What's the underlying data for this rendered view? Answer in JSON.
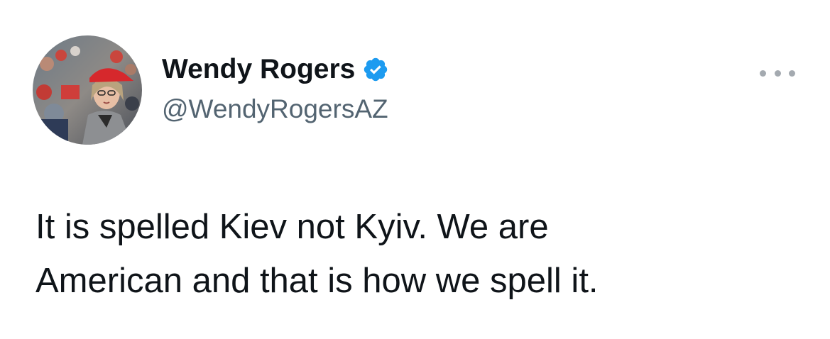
{
  "tweet": {
    "author": {
      "display_name": "Wendy Rogers",
      "handle": "@WendyRogersAZ",
      "verified": true,
      "avatar_icon": "profile-photo"
    },
    "menu_icon": "more-options-icon",
    "text": "It is spelled Kiev not Kyiv. We are\nAmerican and that is how we spell it."
  },
  "colors": {
    "text_primary": "#0f1419",
    "text_secondary": "#536471",
    "verified_blue": "#1d9bf0",
    "background": "#ffffff"
  }
}
